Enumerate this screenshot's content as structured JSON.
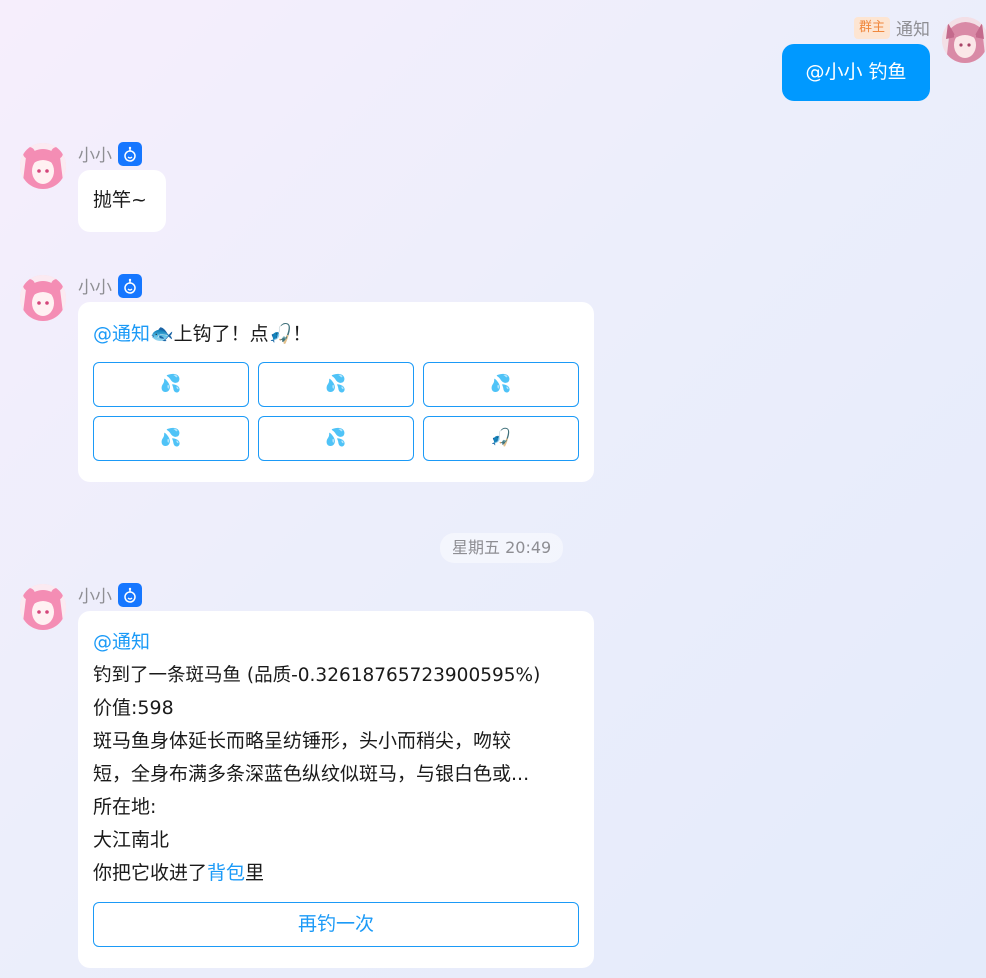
{
  "colors": {
    "accent": "#0099ff",
    "link": "#1b9af7",
    "bot_badge": "#1677ff",
    "owner_badge_bg": "#fde5d2",
    "owner_badge_text": "#f0883e"
  },
  "user_message": {
    "role_badge": "群主",
    "sender": "通知",
    "text": "@小小 钓鱼"
  },
  "messages": [
    {
      "sender": "小小",
      "badge_icon": "robot-icon",
      "text": "抛竿~"
    },
    {
      "sender": "小小",
      "badge_icon": "robot-icon",
      "mention": "@通知",
      "text": "🐟上钩了！点🎣！",
      "buttons": [
        "💦",
        "💦",
        "💦",
        "💦",
        "💦",
        "🎣"
      ]
    },
    {
      "sender": "小小",
      "badge_icon": "robot-icon",
      "mention": "@通知",
      "lines": [
        "钓到了一条斑马鱼 (品质-0.32618765723900595%)",
        "价值:598",
        "斑马鱼身体延长而略呈纺锤形，头小而稍尖，吻较",
        "短，全身布满多条深蓝色纵纹似斑马，与银白色或...",
        "所在地:",
        "大江南北"
      ],
      "last_line_prefix": "你把它收进了",
      "last_line_link": "背包",
      "last_line_suffix": "里",
      "action_button": "再钓一次"
    }
  ],
  "timestamp": "星期五 20:49"
}
